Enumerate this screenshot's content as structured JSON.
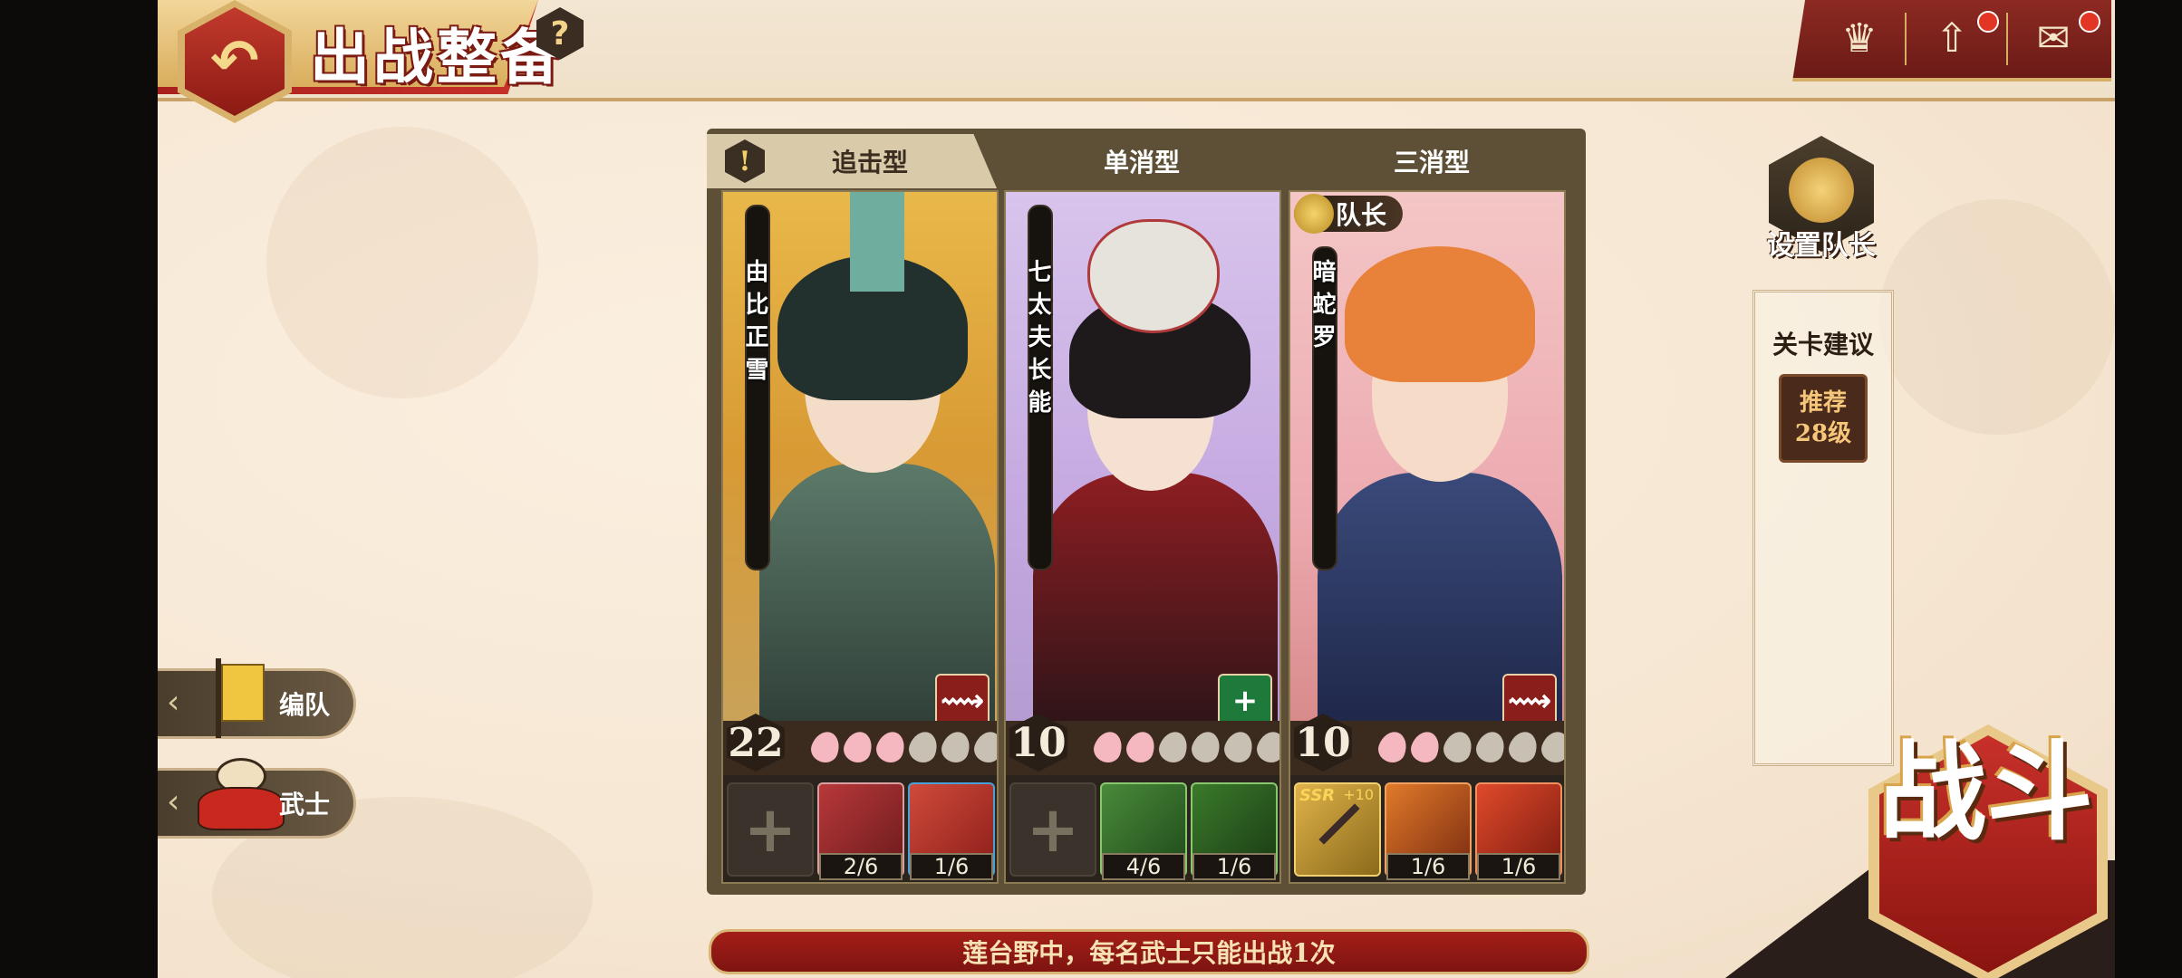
{
  "header": {
    "title": "出战整备",
    "back_icon": "↶",
    "help_label": "?"
  },
  "top_right": {
    "profile_icon": "♛",
    "upgrade_icon": "⇧",
    "mail_icon": "✉"
  },
  "team": {
    "tabs": [
      {
        "label": "追击型"
      },
      {
        "label": "单消型"
      },
      {
        "label": "三消型"
      }
    ],
    "warning_icon": "!",
    "members": [
      {
        "name": "由比正雪",
        "level": "22",
        "petals_filled": 3,
        "petals_total": 6,
        "skill_icon": "⟿",
        "equipment": [
          {
            "empty": true,
            "plus": "+"
          },
          {
            "count": "2/6",
            "color": "#8c2a2a"
          },
          {
            "count": "1/6",
            "color": "#b02a2a"
          }
        ]
      },
      {
        "name": "七太夫长能",
        "level": "10",
        "petals_filled": 2,
        "petals_total": 6,
        "skill_icon": "+",
        "equipment": [
          {
            "empty": true,
            "plus": "+"
          },
          {
            "count": "4/6",
            "color": "#2e6a2a"
          },
          {
            "count": "1/6",
            "color": "#2e6a2a"
          }
        ]
      },
      {
        "name": "暗蛇罗",
        "level": "10",
        "petals_filled": 2,
        "petals_total": 6,
        "skill_icon": "⟿",
        "leader_label": "队长",
        "equipment": [
          {
            "ssr": "SSR",
            "plus": "+10",
            "color": "#c9a23a"
          },
          {
            "count": "1/6",
            "color": "#c25a1a"
          },
          {
            "count": "1/6",
            "color": "#c2381a"
          }
        ]
      }
    ]
  },
  "set_leader": {
    "label": "设置队长"
  },
  "advice": {
    "title": "关卡建议",
    "badge_line1": "推荐",
    "badge_line2": "28级"
  },
  "side_buttons": [
    {
      "label": "编队",
      "chevron": "‹"
    },
    {
      "label": "武士",
      "chevron": "‹"
    }
  ],
  "rule_banner": "莲台野中，每名武士只能出战1次",
  "battle": {
    "label": "战斗"
  },
  "colors": {
    "accent_red": "#a41e18",
    "gold": "#d7b676",
    "panel_brown": "#5e5036"
  }
}
